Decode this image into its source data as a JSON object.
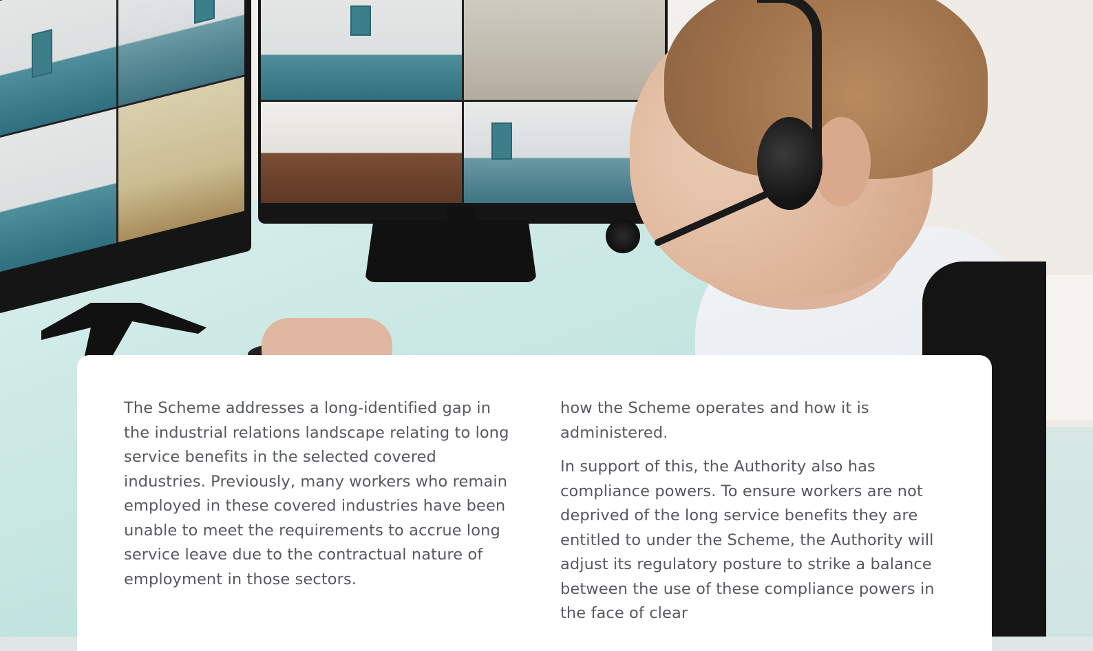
{
  "hero_image": {
    "alt": "",
    "description_icon": "photo-security-operator"
  },
  "article": {
    "column_left": {
      "paragraph_1": "The Scheme addresses a long-identified gap in the industrial relations landscape relating to long service benefits in the selected covered industries. Previously, many workers who remain employed in these covered industries have been unable to meet the requirements to accrue long service leave due to the contractual nature of employment in those sectors."
    },
    "column_right": {
      "paragraph_1": "how the Scheme operates and how it is administered.",
      "paragraph_2": "In support of this, the Authority also has compliance powers. To ensure workers are not deprived of the long service benefits they are entitled to under the Scheme, the Authority will adjust its regulatory posture to strike a balance between the use of these compliance powers in the face of clear"
    }
  },
  "colors": {
    "text": "#555a5e",
    "card": "#ffffff"
  }
}
